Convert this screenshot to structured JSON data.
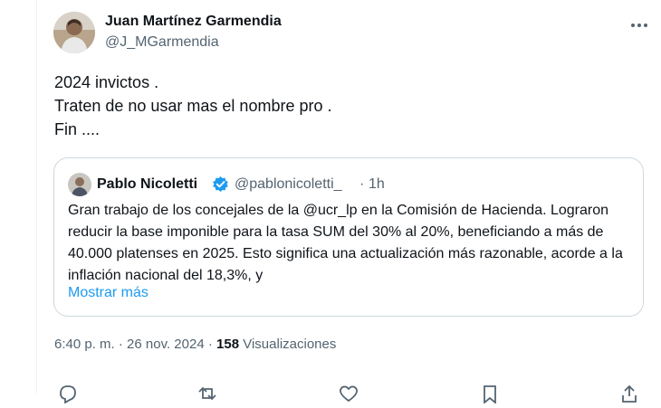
{
  "tweet": {
    "author_name": "Juan Martínez Garmendia",
    "author_handle": "@J_MGarmendia",
    "text": "2024 invictos .\nTraten de no usar mas el nombre pro .\nFin ....",
    "time": "6:40 p. m.",
    "separator": "·",
    "date": "26 nov. 2024",
    "views_count": "158",
    "views_label": "Visualizaciones",
    "more_icon": "more-horizontal-icon"
  },
  "quote": {
    "author_name": "Pablo Nicoletti",
    "author_handle": "@pablonicoletti_",
    "separator": "·",
    "time": "1h",
    "text": "Gran trabajo de los concejales de la @ucr_lp en la Comisión de Hacienda. Lograron reducir la base imponible para la tasa SUM del 30% al 20%, beneficiando a más de 40.000 platenses en 2025. Esto significa una actualización más razonable, acorde a la inflación nacional del 18,3%, y",
    "show_more": "Mostrar más",
    "verified_color": "#1d9bf0"
  },
  "actions": [
    "reply-icon",
    "retweet-icon",
    "like-icon",
    "bookmark-icon",
    "share-icon"
  ]
}
